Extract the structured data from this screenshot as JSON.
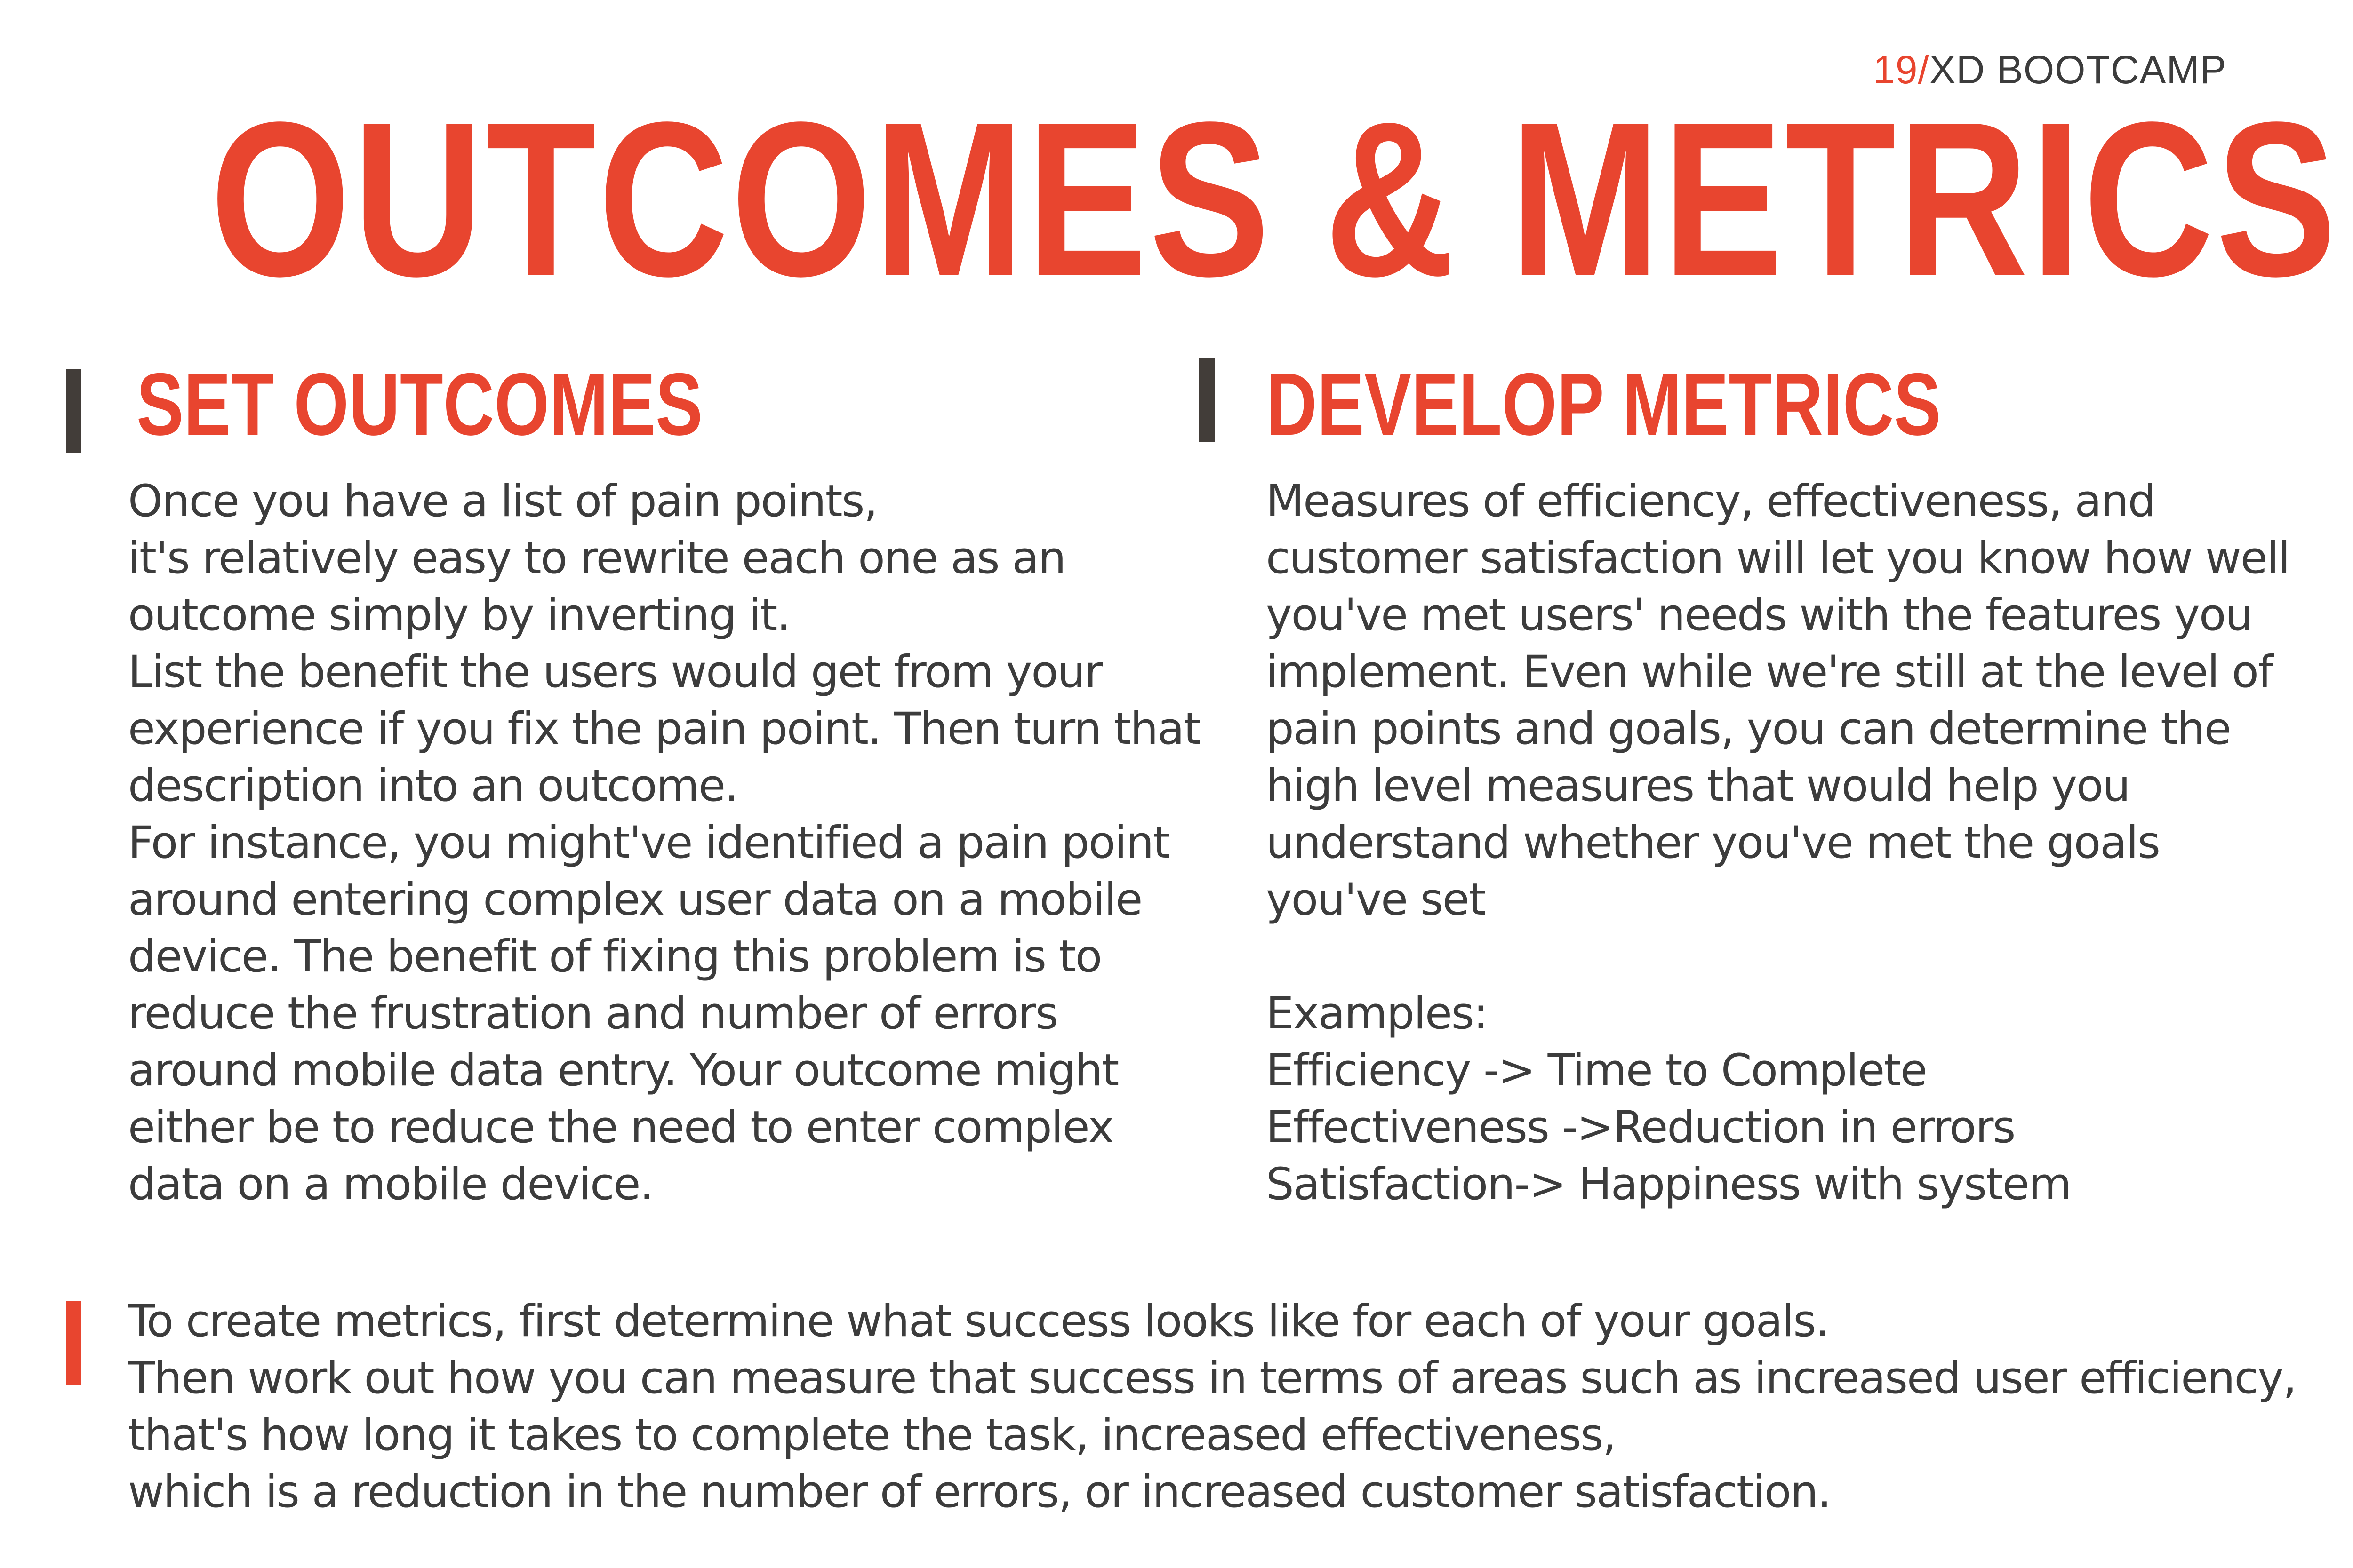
{
  "brand": {
    "number": "19",
    "slash": "/",
    "name": "XD BOOTCAMP"
  },
  "title": "OUTCOMES & METRICS",
  "left_section": {
    "heading": "SET OUTCOMES",
    "lines": [
      "Once you have a list of pain points,",
      "it's relatively easy to rewrite each one as an",
      "outcome simply by inverting it.",
      "List the benefit the users would get from your",
      "experience if you fix the pain point. Then turn that",
      "description into an outcome.",
      "For instance, you might've identified a pain point",
      "around entering complex user data on a mobile",
      "device. The benefit of fixing this problem is to",
      "reduce the frustration and number of errors",
      "around mobile data entry. Your outcome might",
      "either be to reduce the need to enter complex",
      "data on a mobile device."
    ]
  },
  "right_section": {
    "heading": "DEVELOP METRICS",
    "lines": [
      "Measures of efficiency, effectiveness, and",
      "customer satisfaction will let you know how well",
      "you've met users' needs with the features you",
      "implement. Even while we're still at the level of",
      "pain points and goals, you can determine the",
      "high level measures that would help you",
      "understand whether you've met the goals",
      "you've set",
      "",
      "Examples:",
      "Efficiency -> Time to Complete",
      "Effectiveness ->Reduction in errors",
      "Satisfaction-> Happiness with system"
    ]
  },
  "bottom_note": {
    "lines": [
      "To create metrics, first determine what success looks like for each of your goals.",
      "Then work out how you can measure that success in terms of areas such as increased user efficiency,",
      "that's how long it takes to complete the task, increased effectiveness,",
      "which is a reduction in the number of errors, or increased customer satisfaction."
    ]
  },
  "colors": {
    "accent": "#e8452f",
    "text": "#3c3c3c",
    "bar_dark": "#423d39"
  }
}
